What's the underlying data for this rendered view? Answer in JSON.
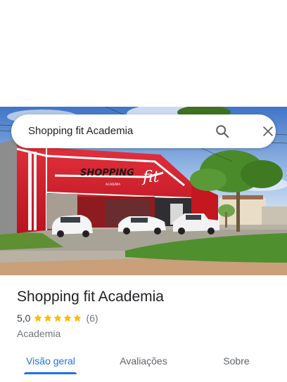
{
  "search": {
    "query": "Shopping fit Academia",
    "search_icon": "search-icon",
    "close_icon": "close-icon"
  },
  "photo": {
    "sign_text": "SHOPPING",
    "sign_script": "fit",
    "sign_sub": "ACADEMIA"
  },
  "place": {
    "title": "Shopping fit Academia",
    "rating": "5,0",
    "stars": 5,
    "reviews": "(6)",
    "category": "Academia"
  },
  "tabs": [
    {
      "label": "Visão geral",
      "active": true
    },
    {
      "label": "Avaliações",
      "active": false
    },
    {
      "label": "Sobre",
      "active": false
    }
  ],
  "colors": {
    "accent": "#1a73e8",
    "star": "#fbbc04",
    "building_red": "#d3202e"
  }
}
